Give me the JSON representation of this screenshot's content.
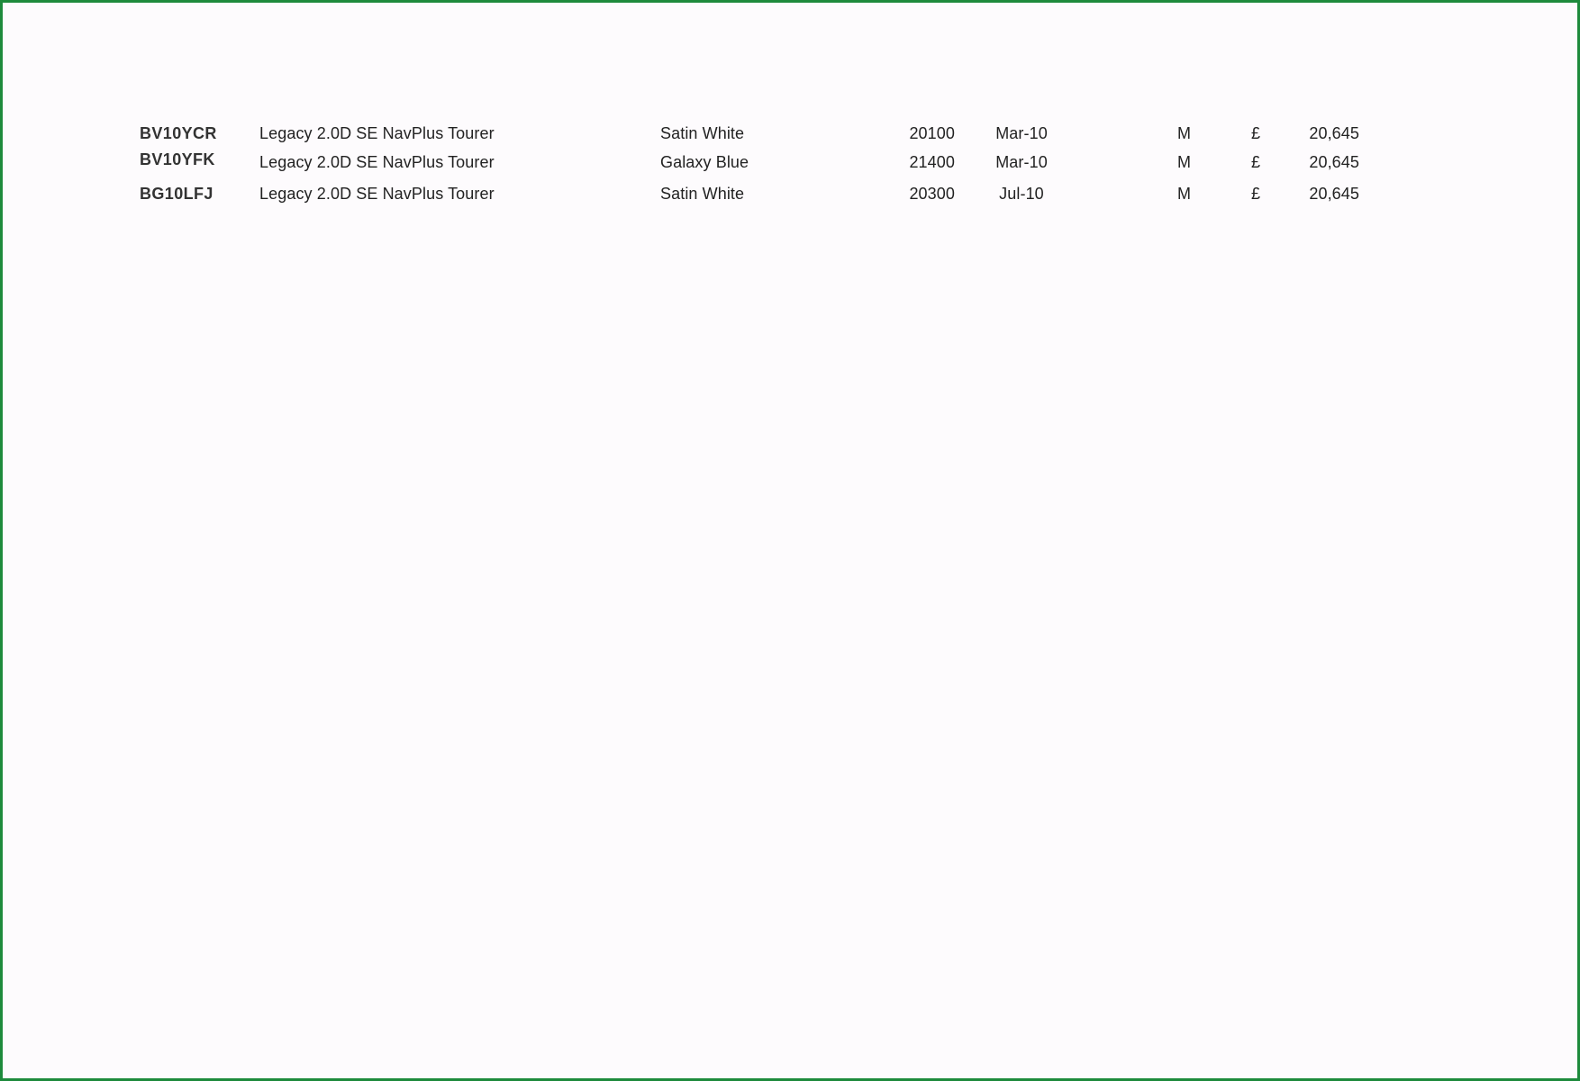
{
  "vehicles": [
    {
      "registration": "BV10YCR",
      "model": "Legacy 2.0D SE NavPlus Tourer",
      "colour": "Satin White",
      "mileage": "20100",
      "date": "Mar-10",
      "transmission": "M",
      "currency": "£",
      "price": "20,645"
    },
    {
      "registration": "BV10YFK",
      "model": "Legacy 2.0D SE NavPlus Tourer",
      "colour": "Galaxy Blue",
      "mileage": "21400",
      "date": "Mar-10",
      "transmission": "M",
      "currency": "£",
      "price": "20,645"
    },
    {
      "registration": "BG10LFJ",
      "model": "Legacy 2.0D SE NavPlus Tourer",
      "colour": "Satin White",
      "mileage": "20300",
      "date": "Jul-10",
      "transmission": "M",
      "currency": "£",
      "price": "20,645"
    }
  ]
}
